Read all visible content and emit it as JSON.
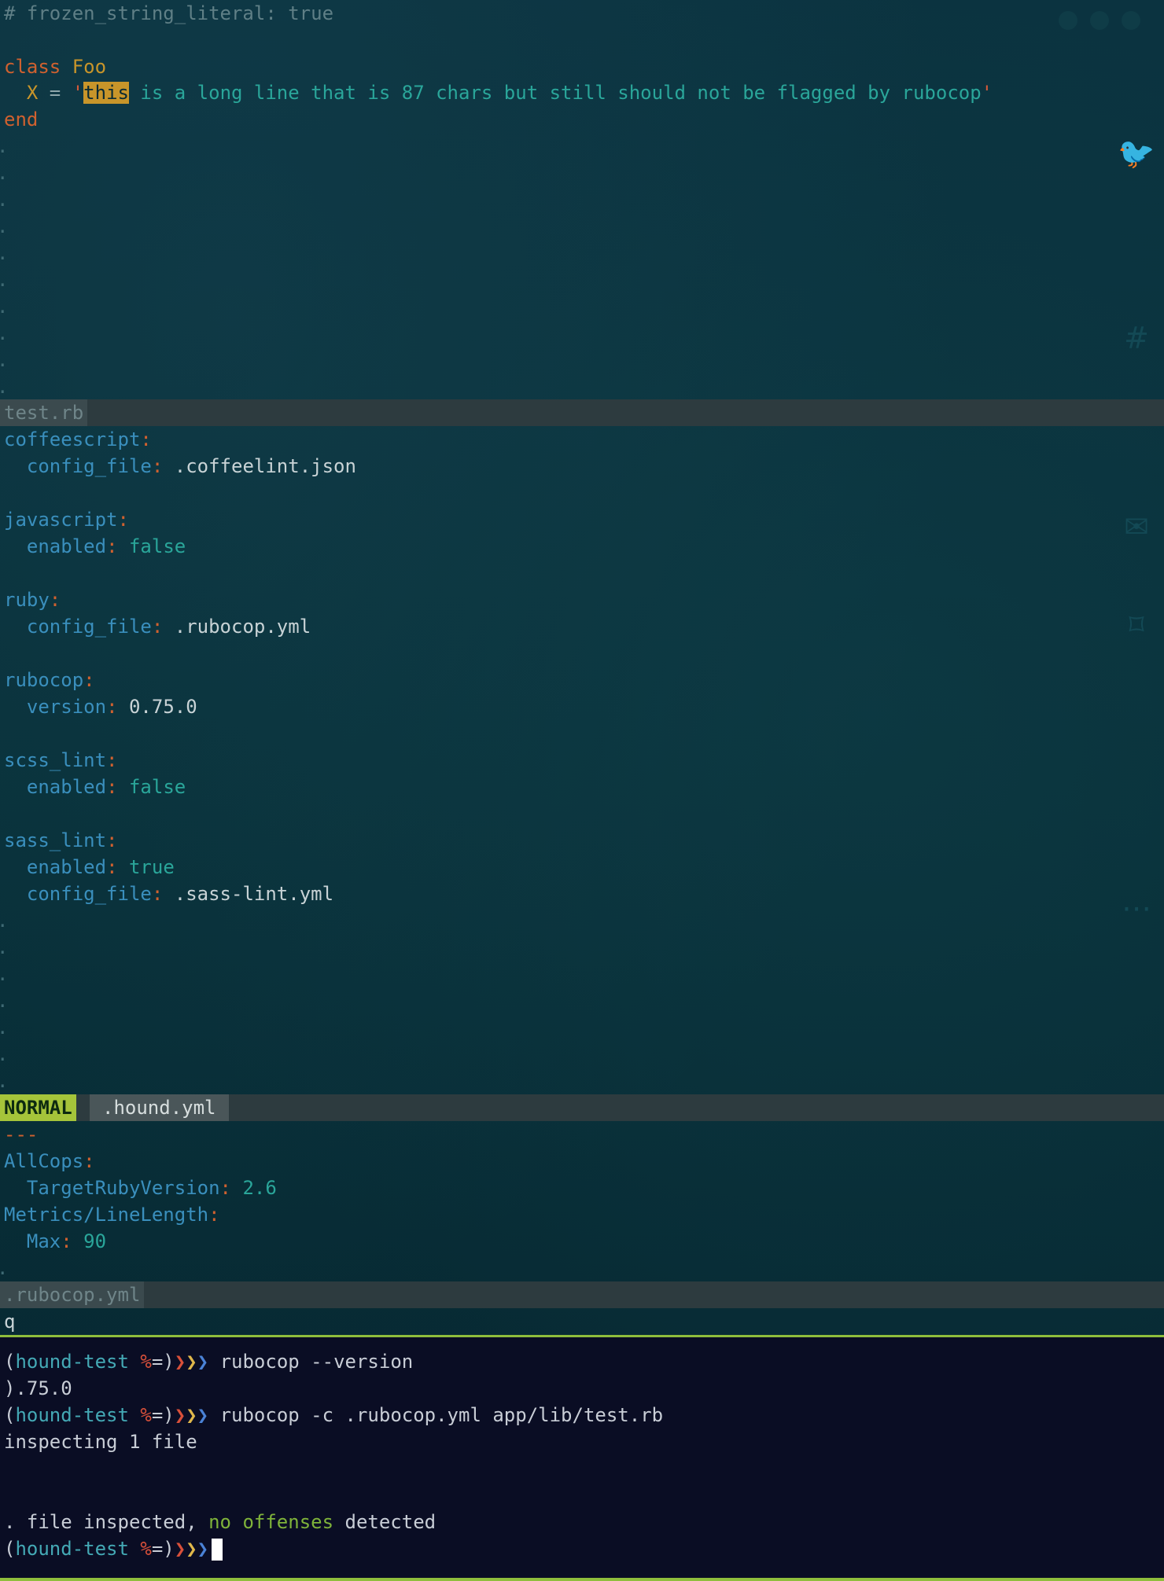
{
  "editor": {
    "pane1": {
      "comment": "# frozen_string_literal: true",
      "line_class": "class",
      "line_class_name": "Foo",
      "const_name": "X",
      "assign": " = ",
      "quote_open": "'",
      "highlight_word": "this",
      "string_rest": " is a long line that is 87 chars but still should not be flagged by rubocop",
      "quote_close": "'",
      "line_end": "end",
      "filename": "test.rb"
    },
    "pane2": {
      "lines": [
        {
          "key": "coffeescript",
          "indent": "",
          "sep": ":",
          "value": "",
          "vtype": "none"
        },
        {
          "key": "config_file",
          "indent": "  ",
          "sep": ":",
          "value": " .coffeelint.json",
          "vtype": "val"
        },
        {
          "key": "",
          "indent": "",
          "sep": "",
          "value": "",
          "vtype": "none"
        },
        {
          "key": "javascript",
          "indent": "",
          "sep": ":",
          "value": "",
          "vtype": "none"
        },
        {
          "key": "enabled",
          "indent": "  ",
          "sep": ":",
          "value": " false",
          "vtype": "bool"
        },
        {
          "key": "",
          "indent": "",
          "sep": "",
          "value": "",
          "vtype": "none"
        },
        {
          "key": "ruby",
          "indent": "",
          "sep": ":",
          "value": "",
          "vtype": "none"
        },
        {
          "key": "config_file",
          "indent": "  ",
          "sep": ":",
          "value": " .rubocop.yml",
          "vtype": "val"
        },
        {
          "key": "",
          "indent": "",
          "sep": "",
          "value": "",
          "vtype": "none"
        },
        {
          "key": "rubocop",
          "indent": "",
          "sep": ":",
          "value": "",
          "vtype": "none"
        },
        {
          "key": "version",
          "indent": "  ",
          "sep": ":",
          "value": " 0.75.0",
          "vtype": "val"
        },
        {
          "key": "",
          "indent": "",
          "sep": "",
          "value": "",
          "vtype": "none"
        },
        {
          "key": "scss_lint",
          "indent": "",
          "sep": ":",
          "value": "",
          "vtype": "none"
        },
        {
          "key": "enabled",
          "indent": "  ",
          "sep": ":",
          "value": " false",
          "vtype": "bool"
        },
        {
          "key": "",
          "indent": "",
          "sep": "",
          "value": "",
          "vtype": "none"
        },
        {
          "key": "sass_lint",
          "indent": "",
          "sep": ":",
          "value": "",
          "vtype": "none"
        },
        {
          "key": "enabled",
          "indent": "  ",
          "sep": ":",
          "value": " true",
          "vtype": "bool"
        },
        {
          "key": "config_file",
          "indent": "  ",
          "sep": ":",
          "value": " .sass-lint.yml",
          "vtype": "val"
        }
      ],
      "mode": "NORMAL",
      "filename": ".hound.yml"
    },
    "pane3": {
      "doc_start": "---",
      "lines": [
        {
          "key": "AllCops",
          "indent": "",
          "sep": ":",
          "value": "",
          "vtype": "none"
        },
        {
          "key": "TargetRubyVersion",
          "indent": "  ",
          "sep": ":",
          "value": " 2.6",
          "vtype": "num"
        },
        {
          "key": "Metrics/LineLength",
          "indent": "",
          "sep": ":",
          "value": "",
          "vtype": "none"
        },
        {
          "key": "Max",
          "indent": "  ",
          "sep": ":",
          "value": " 90",
          "vtype": "num"
        }
      ],
      "filename": ".rubocop.yml"
    },
    "command_line": "q"
  },
  "terminal": {
    "prompt": {
      "open": "(",
      "env": "hound-test",
      "pct": " %",
      "close": "=)",
      "arrow1": "❯",
      "arrow2": "❯",
      "arrow3": "❯"
    },
    "cmd1": " rubocop --version",
    "out1": ").75.0",
    "cmd2": " rubocop -c .rubocop.yml app/lib/test.rb",
    "out2": "inspecting 1 file",
    "out3_a": ". file inspected, ",
    "out3_b": "no offenses",
    "out3_c": " detected"
  },
  "colors": {
    "editor_bg": "#082a33",
    "terminal_bg": "#0a0d24",
    "mode_bg": "#a5c43a",
    "accent_green": "#8fbe3c"
  }
}
